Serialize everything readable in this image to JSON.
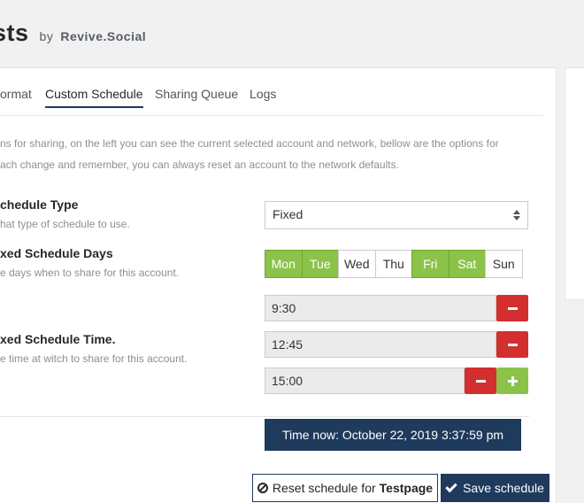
{
  "header": {
    "title": "sts",
    "by": "by",
    "brand": "Revive.Social"
  },
  "tabs": [
    {
      "label": "ormat"
    },
    {
      "label": "Custom Schedule",
      "active": true
    },
    {
      "label": "Sharing Queue"
    },
    {
      "label": "Logs"
    }
  ],
  "intro": {
    "line1": "ns for sharing, on the left you can see the current selected account and network, bellow are the options for",
    "line2": "ach change and remember, you can always reset an account to the network defaults."
  },
  "schedule_type": {
    "label": "chedule Type",
    "help": "hat type of schedule to use.",
    "value": "Fixed"
  },
  "schedule_days": {
    "label": "xed Schedule Days",
    "help": "e days when to share for this account.",
    "days": [
      {
        "label": "Mon",
        "selected": true
      },
      {
        "label": "Tue",
        "selected": true
      },
      {
        "label": "Wed",
        "selected": false
      },
      {
        "label": "Thu",
        "selected": false
      },
      {
        "label": "Fri",
        "selected": true
      },
      {
        "label": "Sat",
        "selected": true
      },
      {
        "label": "Sun",
        "selected": false
      }
    ]
  },
  "schedule_time": {
    "label": "xed Schedule Time.",
    "help": "e time at witch to share for this account.",
    "times": [
      "9:30",
      "12:45",
      "15:00"
    ]
  },
  "time_now": "Time now: October 22, 2019 3:37:59 pm",
  "actions": {
    "reset_label": "Reset schedule for",
    "reset_account": "Testpage",
    "save_label": "Save schedule"
  },
  "colors": {
    "accent_navy": "#1e3a5c",
    "day_selected": "#8bc34a",
    "remove_red": "#d32f2f",
    "add_green": "#8bc34a"
  },
  "icons": {
    "remove": "minus-icon",
    "add": "plus-icon",
    "reset": "ban-icon",
    "save": "check-icon",
    "select": "sort-caret-icon"
  }
}
